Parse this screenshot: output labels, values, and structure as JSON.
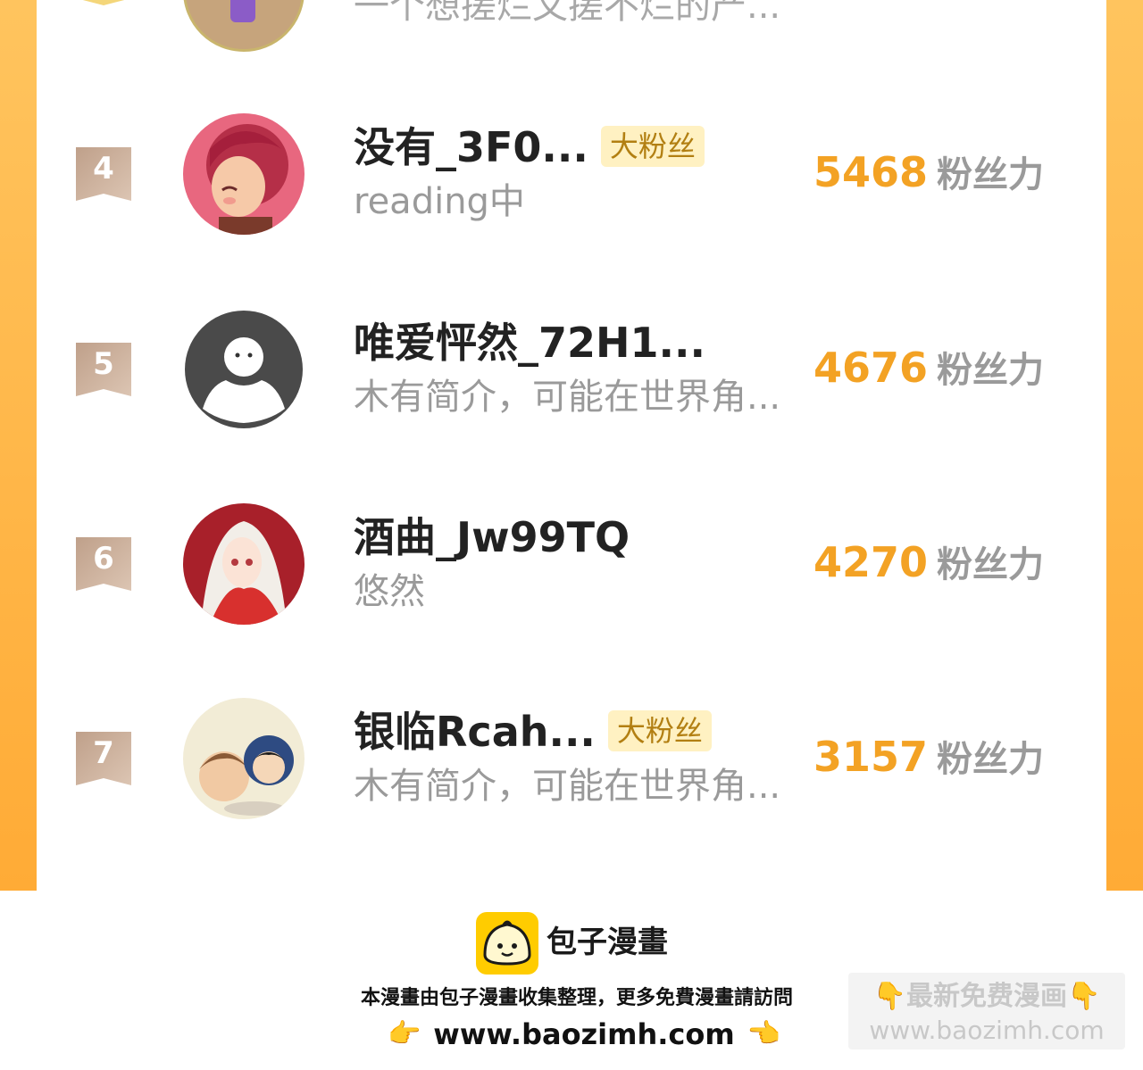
{
  "top_partial": {
    "bio": "一个想搓烂文搓不烂的产..."
  },
  "ranking": [
    {
      "rank": "4",
      "name": "没有_3F0...",
      "badge": "大粉丝",
      "bio": "reading中",
      "score": "5468",
      "unit": "粉丝力",
      "avatar": "avatar-red-hair-girl"
    },
    {
      "rank": "5",
      "name": "唯爱怦然_72H1...",
      "badge": "",
      "bio": "木有简介，可能在世界角...",
      "score": "4676",
      "unit": "粉丝力",
      "avatar": "avatar-default-person"
    },
    {
      "rank": "6",
      "name": "酒曲_Jw99TQ",
      "badge": "",
      "bio": "悠然",
      "score": "4270",
      "unit": "粉丝力",
      "avatar": "avatar-white-hair-red-hood"
    },
    {
      "rank": "7",
      "name": "银临Rcah...",
      "badge": "大粉丝",
      "bio": "木有简介，可能在世界角...",
      "score": "3157",
      "unit": "粉丝力",
      "avatar": "avatar-two-chibi-boys"
    }
  ],
  "footer": {
    "brand": "包子漫畫",
    "note": "本漫畫由包子漫畫收集整理，更多免費漫畫請訪問",
    "url": "www.baozimh.com",
    "hand_left": "👉",
    "hand_right": "👈",
    "watermark_line1": "👇最新免费漫画👇",
    "watermark_line2": "www.baozimh.com"
  },
  "colors": {
    "accent": "#f3a224",
    "frame": "#ffb43f",
    "badge_bg": "#fff1c2",
    "rank_flag": "#c9ad98"
  }
}
